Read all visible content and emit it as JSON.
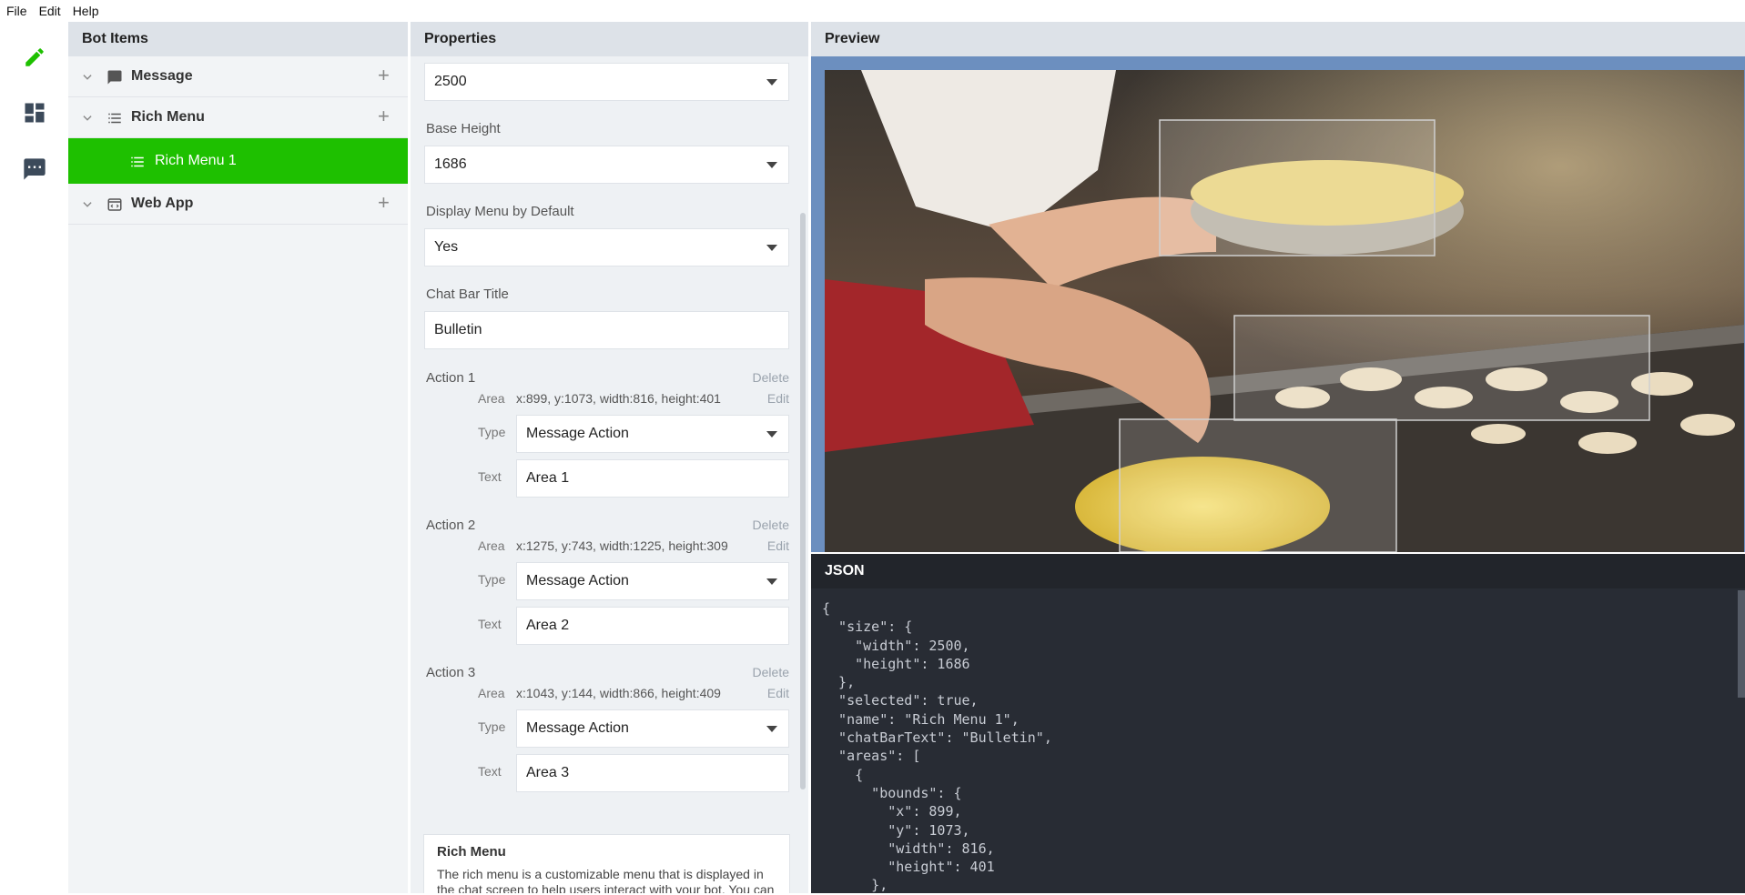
{
  "menu": {
    "file": "File",
    "edit": "Edit",
    "help": "Help"
  },
  "bot_items": {
    "title": "Bot Items",
    "items": [
      {
        "label": "Message",
        "icon": "chat-bubble-icon"
      },
      {
        "label": "Rich Menu",
        "icon": "list-icon"
      },
      {
        "label": "Rich Menu 1",
        "icon": "list-icon"
      },
      {
        "label": "Web App",
        "icon": "web-app-icon"
      }
    ]
  },
  "properties": {
    "title": "Properties",
    "width_value": "2500",
    "base_height_label": "Base Height",
    "base_height_value": "1686",
    "display_menu_label": "Display Menu by Default",
    "display_menu_value": "Yes",
    "chat_bar_label": "Chat Bar Title",
    "chat_bar_value": "Bulletin",
    "actions": [
      {
        "title": "Action 1",
        "delete": "Delete",
        "area_label": "Area",
        "area": "x:899, y:1073, width:816, height:401",
        "edit": "Edit",
        "type_label": "Type",
        "type": "Message Action",
        "text_label": "Text",
        "text": "Area 1"
      },
      {
        "title": "Action 2",
        "delete": "Delete",
        "area_label": "Area",
        "area": "x:1275, y:743, width:1225, height:309",
        "edit": "Edit",
        "type_label": "Type",
        "type": "Message Action",
        "text_label": "Text",
        "text": "Area 2"
      },
      {
        "title": "Action 3",
        "delete": "Delete",
        "area_label": "Area",
        "area": "x:1043, y:144, width:866, height:409",
        "edit": "Edit",
        "type_label": "Type",
        "type": "Message Action",
        "text_label": "Text",
        "text": "Area 3"
      }
    ],
    "info": {
      "title": "Rich Menu",
      "text": "The rich menu is a customizable menu that is displayed in the chat screen to help users interact with your bot. You can customize the menu items to correspond to"
    }
  },
  "preview": {
    "title": "Preview"
  },
  "json_panel": {
    "title": "JSON",
    "code": "{\n  \"size\": {\n    \"width\": 2500,\n    \"height\": 1686\n  },\n  \"selected\": true,\n  \"name\": \"Rich Menu 1\",\n  \"chatBarText\": \"Bulletin\",\n  \"areas\": [\n    {\n      \"bounds\": {\n        \"x\": 899,\n        \"y\": 1073,\n        \"width\": 816,\n        \"height\": 401\n      },"
  },
  "colors": {
    "accent": "#1ec000",
    "panel": "#dde2e8",
    "json_bg": "#282c34"
  }
}
